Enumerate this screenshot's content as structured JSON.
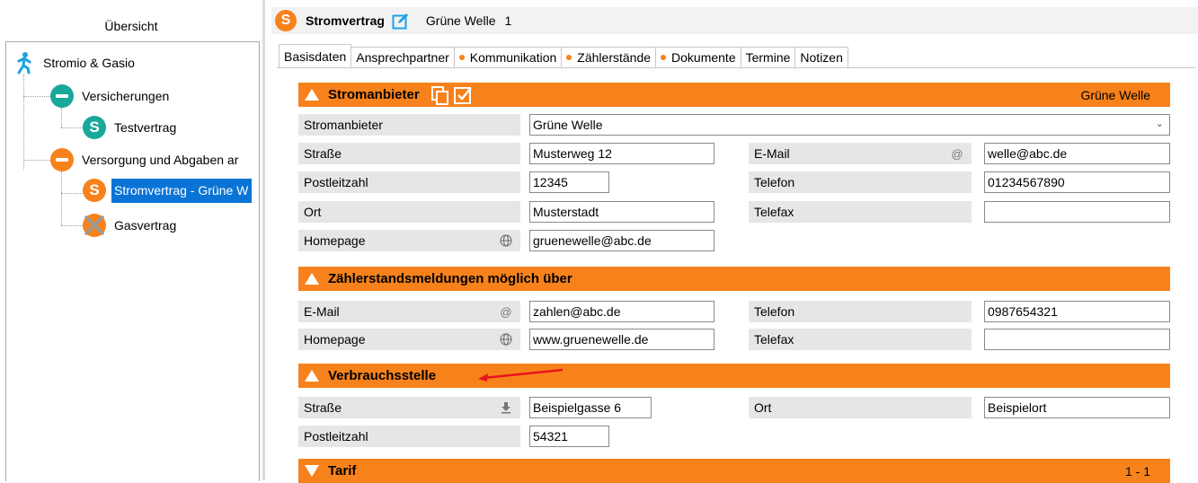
{
  "left": {
    "title": "Übersicht",
    "tree": {
      "root": "Stromio & Gasio",
      "group1": "Versicherungen",
      "item1_letter": "S",
      "item1": "Testvertrag",
      "group2": "Versorgung und Abgaben ar",
      "item2_letter": "S",
      "item2": "Stromvertrag - Grüne W",
      "item3": "Gasvertrag"
    }
  },
  "header": {
    "letter": "S",
    "title": "Stromvertrag",
    "subtitle": "Grüne Welle",
    "count": "1"
  },
  "tabs": [
    {
      "label": "Basisdaten",
      "dot": false
    },
    {
      "label": "Ansprechpartner",
      "dot": false
    },
    {
      "label": "Kommunikation",
      "dot": true
    },
    {
      "label": "Zählerstände",
      "dot": true
    },
    {
      "label": "Dokumente",
      "dot": true
    },
    {
      "label": "Termine",
      "dot": false
    },
    {
      "label": "Notizen",
      "dot": false
    }
  ],
  "sections": {
    "stromanbieter": {
      "title": "Stromanbieter",
      "right": "Grüne Welle",
      "labels": {
        "anbieter": "Stromanbieter",
        "strasse": "Straße",
        "plz": "Postleitzahl",
        "ort": "Ort",
        "homepage": "Homepage",
        "email": "E-Mail",
        "telefon": "Telefon",
        "telefax": "Telefax"
      },
      "values": {
        "anbieter": "Grüne Welle",
        "strasse": "Musterweg 12",
        "plz": "12345",
        "ort": "Musterstadt",
        "homepage": "gruenewelle@abc.de",
        "email": "welle@abc.de",
        "telefon": "01234567890",
        "telefax": ""
      }
    },
    "zaehler": {
      "title": "Zählerstandsmeldungen möglich über",
      "labels": {
        "email": "E-Mail",
        "homepage": "Homepage",
        "telefon": "Telefon",
        "telefax": "Telefax"
      },
      "values": {
        "email": "zahlen@abc.de",
        "homepage": "www.gruenewelle.de",
        "telefon": "0987654321",
        "telefax": ""
      }
    },
    "verbrauch": {
      "title": "Verbrauchsstelle",
      "labels": {
        "strasse": "Straße",
        "plz": "Postleitzahl",
        "ort": "Ort"
      },
      "values": {
        "strasse": "Beispielgasse 6",
        "plz": "54321",
        "ort": "Beispielort"
      }
    },
    "tarif": {
      "title": "Tarif",
      "right": "1 - 1"
    }
  },
  "colors": {
    "accent": "#f7821b",
    "teal": "#1aa89a",
    "selection": "#0a74d6",
    "walker": "#1aa2e6",
    "annotation_arrow": "#e8141c"
  },
  "icons": {
    "email": "at-icon",
    "homepage": "globe-icon",
    "download": "download-arrow-icon"
  }
}
